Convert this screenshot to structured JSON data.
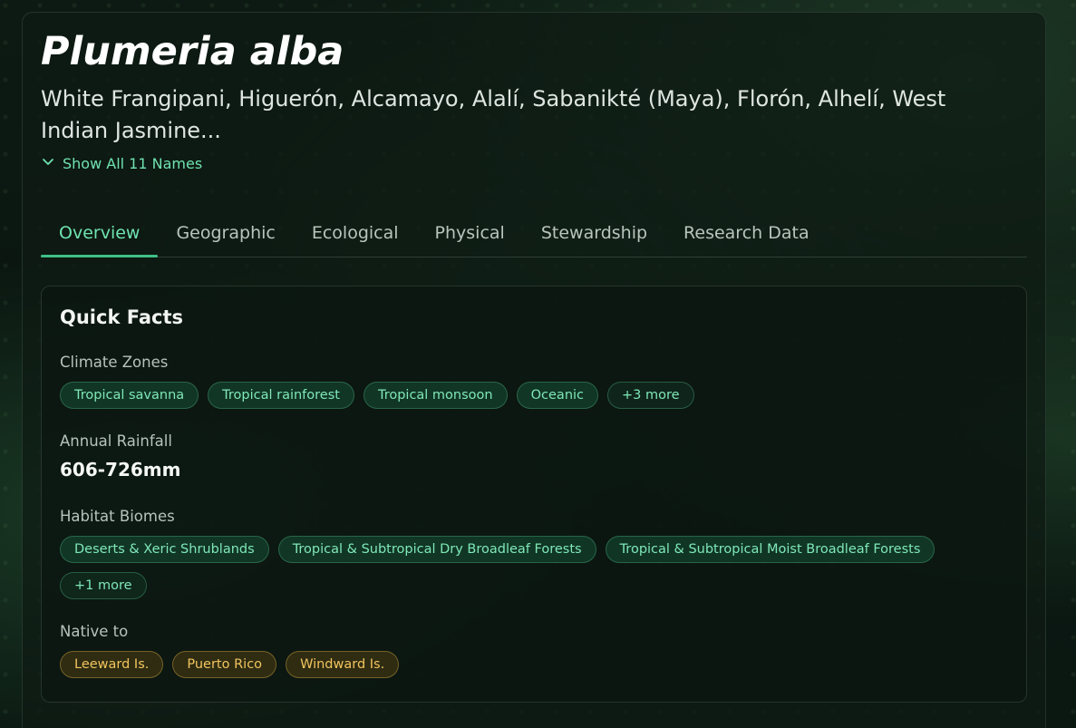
{
  "species": {
    "scientific_name": "Plumeria alba",
    "common_names": "White Frangipani, Higuerón, Alcamayo, Alalí, Sabanikté (Maya), Florón, Alhelí, West Indian Jasmine...",
    "show_all_label": "Show All 11 Names",
    "show_all_icon": "chevron-down-icon"
  },
  "tabs": [
    {
      "label": "Overview",
      "active": true
    },
    {
      "label": "Geographic"
    },
    {
      "label": "Ecological"
    },
    {
      "label": "Physical"
    },
    {
      "label": "Stewardship"
    },
    {
      "label": "Research Data"
    }
  ],
  "quick_facts": {
    "title": "Quick Facts",
    "climate_zones": {
      "label": "Climate Zones",
      "chips": [
        "Tropical savanna",
        "Tropical rainforest",
        "Tropical monsoon",
        "Oceanic"
      ],
      "more": "+3 more"
    },
    "annual_rainfall": {
      "label": "Annual Rainfall",
      "value": "606-726mm"
    },
    "habitat_biomes": {
      "label": "Habitat Biomes",
      "chips": [
        "Deserts & Xeric Shrublands",
        "Tropical & Subtropical Dry Broadleaf Forests",
        "Tropical & Subtropical Moist Broadleaf Forests"
      ],
      "more": "+1 more"
    },
    "native_to": {
      "label": "Native to",
      "chips": [
        "Leeward Is.",
        "Puerto Rico",
        "Windward Is."
      ]
    }
  },
  "colors": {
    "accent": "#6fe3b0",
    "chip_green": "#7fe8b8",
    "chip_gold": "#f2c45e"
  }
}
